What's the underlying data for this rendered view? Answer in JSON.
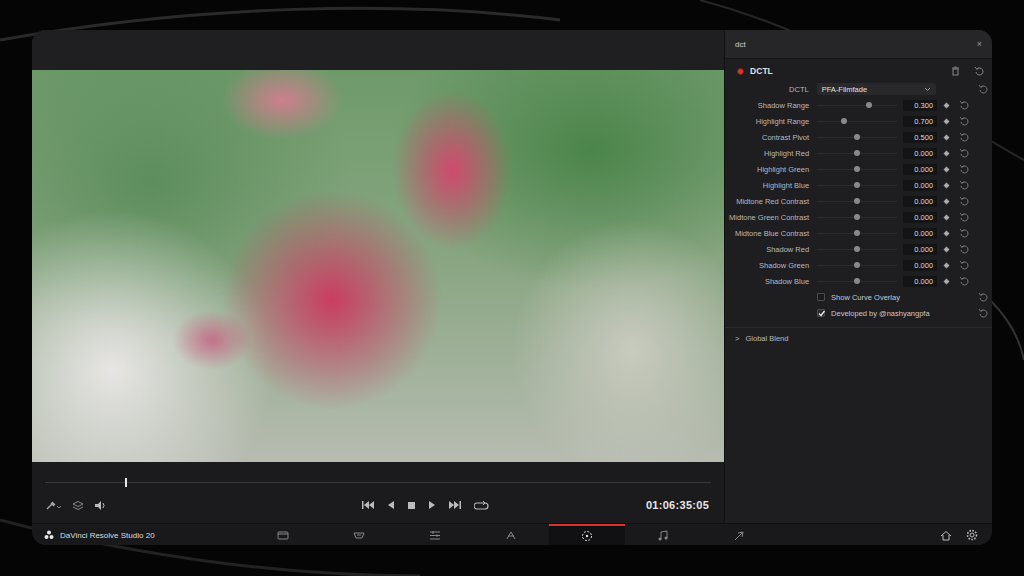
{
  "window": {
    "app_title": "DaVinci Resolve Studio 20"
  },
  "viewer": {
    "playhead": {
      "level": 0.12
    },
    "timecode": "01:06:35:05"
  },
  "pages": [
    {
      "kind": "media",
      "selected": false
    },
    {
      "kind": "cut",
      "selected": false
    },
    {
      "kind": "edit",
      "selected": false
    },
    {
      "kind": "fusion",
      "selected": false
    },
    {
      "kind": "color",
      "selected": true
    },
    {
      "kind": "fairlight",
      "selected": false
    },
    {
      "kind": "deliver",
      "selected": false
    }
  ],
  "search": {
    "value": "dct",
    "clear": "×"
  },
  "effect": {
    "name": "DCTL",
    "enabled": true,
    "params": [
      {
        "kind": "dropdown",
        "label": "DCTL",
        "value": "PFA-Filmfade"
      },
      {
        "kind": "slider",
        "label": "Shadow Range",
        "value": "0.300",
        "level": 0.65
      },
      {
        "kind": "slider",
        "label": "Highlight Range",
        "value": "0.700",
        "level": 0.33
      },
      {
        "kind": "slider",
        "label": "Contrast Pivot",
        "value": "0.500",
        "level": 0.5
      },
      {
        "kind": "slider",
        "label": "Highlight Red",
        "value": "0.000",
        "level": 0.5
      },
      {
        "kind": "slider",
        "label": "Highlight Green",
        "value": "0.000",
        "level": 0.5
      },
      {
        "kind": "slider",
        "label": "Highlight Blue",
        "value": "0.000",
        "level": 0.5
      },
      {
        "kind": "slider",
        "label": "Midtone Red Contrast",
        "value": "0.000",
        "level": 0.5
      },
      {
        "kind": "slider",
        "label": "Midtone Green Contrast",
        "value": "0.000",
        "level": 0.5
      },
      {
        "kind": "slider",
        "label": "Midtone Blue Contrast",
        "value": "0.000",
        "level": 0.5
      },
      {
        "kind": "slider",
        "label": "Shadow Red",
        "value": "0.000",
        "level": 0.5
      },
      {
        "kind": "slider",
        "label": "Shadow Green",
        "value": "0.000",
        "level": 0.5
      },
      {
        "kind": "slider",
        "label": "Shadow Blue",
        "value": "0.000",
        "level": 0.5
      },
      {
        "kind": "checkbox",
        "label": "Show Curve Overlay",
        "checked": false
      },
      {
        "kind": "checkbox",
        "label": "Developed by @nashyangpfa",
        "checked": true
      }
    ],
    "global_blend": {
      "label": "Global Blend",
      "arrow": ">",
      "expanded": false
    }
  }
}
